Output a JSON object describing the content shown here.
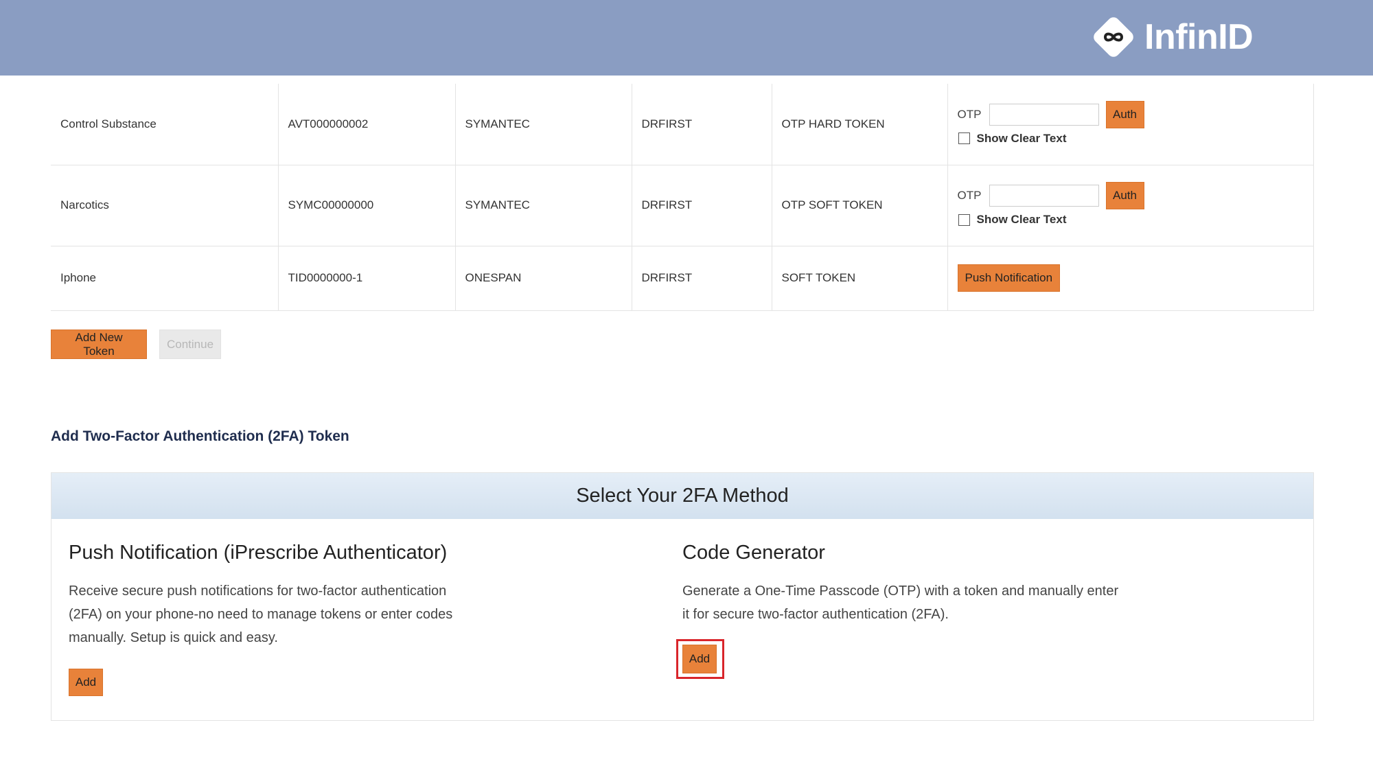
{
  "header": {
    "brand": "InfinID",
    "logo_icon": "infinity-diamond-icon",
    "background": "#8a9dc2"
  },
  "tokens": [
    {
      "purpose": "Control Substance",
      "serial": "AVT000000002",
      "vendor": "SYMANTEC",
      "issuer": "DRFIRST",
      "type": "OTP HARD TOKEN",
      "action": "otp"
    },
    {
      "purpose": "Narcotics",
      "serial": "SYMC00000000",
      "vendor": "SYMANTEC",
      "issuer": "DRFIRST",
      "type": "OTP SOFT TOKEN",
      "action": "otp"
    },
    {
      "purpose": "Iphone",
      "serial": "TID0000000-1",
      "vendor": "ONESPAN",
      "issuer": "DRFIRST",
      "type": "SOFT TOKEN",
      "action": "push"
    }
  ],
  "otp": {
    "label": "OTP",
    "value": "",
    "auth_label": "Auth",
    "show_clear_text_label": "Show Clear Text",
    "show_clear_text_checked": false
  },
  "push_notification_label": "Push Notification",
  "actions": {
    "add_new_token_label": "Add New Token",
    "continue_label": "Continue",
    "continue_enabled": false
  },
  "add_section": {
    "title": "Add Two-Factor Authentication (2FA) Token",
    "header": "Select Your 2FA Method",
    "methods": [
      {
        "title": "Push Notification (iPrescribe Authenticator)",
        "description": "Receive secure push notifications for two-factor authentication (2FA) on your phone-no need to manage tokens or enter codes manually. Setup is quick and easy.",
        "button_label": "Add"
      },
      {
        "title": "Code Generator",
        "description": "Generate a One-Time Passcode (OTP) with a token and manually enter it for secure two-factor authentication (2FA).",
        "button_label": "Add"
      }
    ]
  },
  "colors": {
    "accent": "#e8823a",
    "focus_ring": "#d9252b",
    "heading": "#1f2d4e"
  }
}
